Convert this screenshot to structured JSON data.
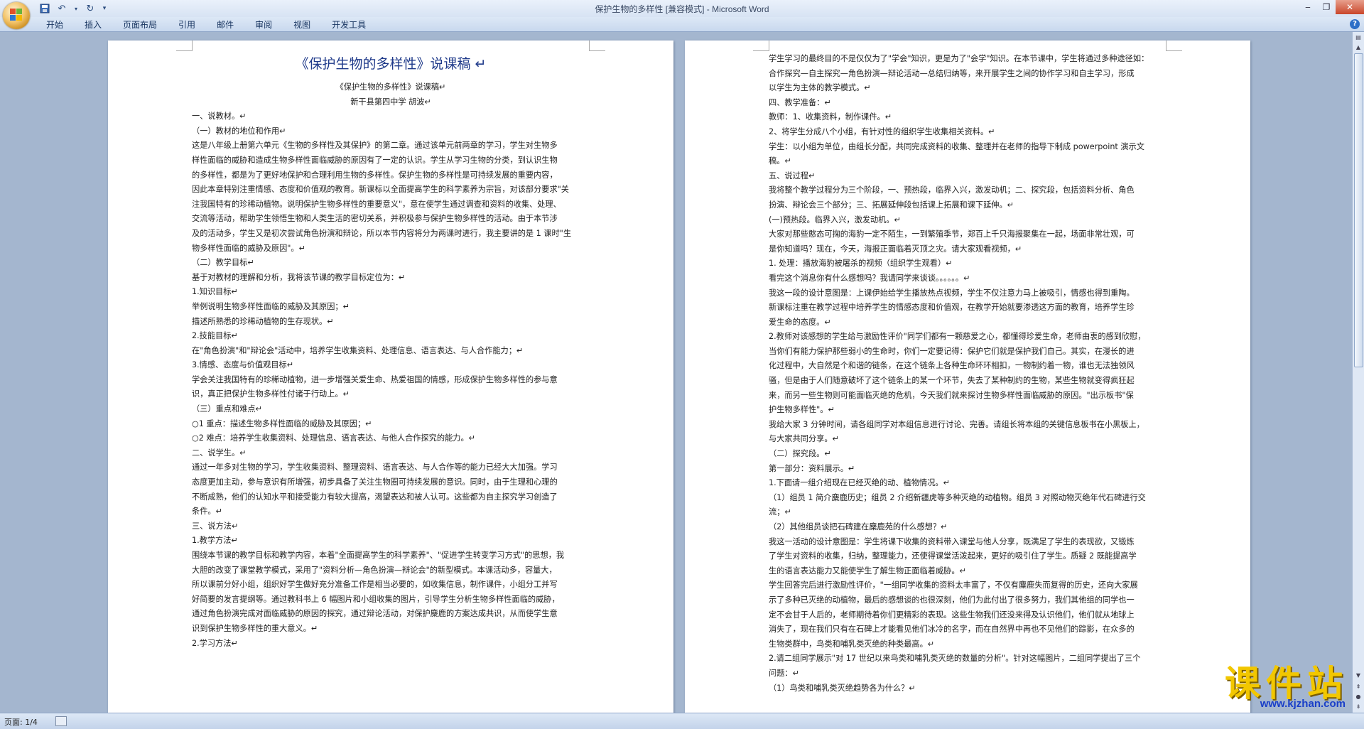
{
  "window": {
    "title": "保护生物的多样性 [兼容模式] - Microsoft Word"
  },
  "quick_access": {
    "icons": [
      "save-icon",
      "undo-icon",
      "redo-icon",
      "customize-icon"
    ]
  },
  "ribbon": {
    "tabs": [
      "开始",
      "插入",
      "页面布局",
      "引用",
      "邮件",
      "审阅",
      "视图",
      "开发工具"
    ]
  },
  "status": {
    "page": "页面: 1/4"
  },
  "watermark": {
    "main": "课件站",
    "url": "www.kjzhan.com"
  },
  "page1": {
    "title": "《保护生物的多样性》说课稿 ↵",
    "lines": [
      "《保护生物的多样性》说课稿↵",
      "新干县第四中学  胡波↵",
      "一、说教材。↵",
      "（一）教材的地位和作用↵",
      "这是八年级上册第六单元《生物的多样性及其保护》的第二章。通过该单元前两章的学习，学生对生物多",
      "样性面临的威胁和造成生物多样性面临威胁的原因有了一定的认识。学生从学习生物的分类，到认识生物",
      "的多样性，都是为了更好地保护和合理利用生物的多样性。保护生物的多样性是可持续发展的重要内容，",
      "因此本章特别注重情感、态度和价值观的教育。新课标以全面提高学生的科学素养为宗旨，对该部分要求\"关",
      "注我国特有的珍稀动植物。说明保护生物多样性的重要意义\"，意在使学生通过调查和资料的收集、处理、",
      "交流等活动，帮助学生领悟生物和人类生活的密切关系，并积极参与保护生物多样性的活动。由于本节涉",
      "及的活动多，学生又是初次尝试角色扮演和辩论，所以本节内容将分为两课时进行，我主要讲的是 1 课时\"生",
      "物多样性面临的威胁及原因\"。↵",
      "（二）教学目标↵",
      "基于对教材的理解和分析，我将该节课的教学目标定位为：↵",
      "1.知识目标↵",
      "举例说明生物多样性面临的威胁及其原因；↵",
      "描述所熟悉的珍稀动植物的生存现状。↵",
      "2.技能目标↵",
      "在\"角色扮演\"和\"辩论会\"活动中，培养学生收集资料、处理信息、语言表达、与人合作能力；↵",
      "3.情感、态度与价值观目标↵",
      "学会关注我国特有的珍稀动植物，进一步增强关爱生命、热爱祖国的情感，形成保护生物多样性的参与意",
      "识，真正把保护生物多样性付诸于行动上。↵",
      "（三）重点和难点↵",
      "○1 重点：描述生物多样性面临的威胁及其原因；↵",
      "○2 难点：培养学生收集资料、处理信息、语言表达、与他人合作探究的能力。↵",
      "二、说学生。↵",
      "通过一年多对生物的学习，学生收集资料、整理资料、语言表达、与人合作等的能力已经大大加强。学习",
      "态度更加主动，参与意识有所增强，初步具备了关注生物圈可持续发展的意识。同时，由于生理和心理的",
      "不断成熟，他们的认知水平和接受能力有较大提高，渴望表达和被人认可。这些都为自主探究学习创造了",
      "条件。↵",
      "三、说方法↵",
      "1.教学方法↵",
      "围绕本节课的教学目标和教学内容，本着\"全面提高学生的科学素养\"、\"促进学生转变学习方式\"的思想，我",
      "大胆的改变了课堂教学模式，采用了\"资料分析—角色扮演—辩论会\"的新型模式。本课活动多，容量大，",
      "所以课前分好小组，组织好学生做好充分准备工作是相当必要的，如收集信息，制作课件，小组分工并写",
      "好简要的发言提纲等。通过教科书上 6 幅图片和小组收集的图片，引导学生分析生物多样性面临的威胁，",
      "通过角色扮演完成对面临威胁的原因的探究，通过辩论活动，对保护麋鹿的方案达成共识，从而使学生意",
      "识到保护生物多样性的重大意义。↵",
      "2.学习方法↵"
    ]
  },
  "page2": {
    "lines": [
      "学生学习的最终目的不是仅仅为了\"学会\"知识，更是为了\"会学\"知识。在本节课中，学生将通过多种途径如：",
      "合作探究—自主探究—角色扮演—辩论活动—总结归纳等，来开展学生之间的协作学习和自主学习，形成",
      "以学生为主体的教学模式。↵",
      "四、教学准备：↵",
      "教师：1、收集资料，制作课件。↵",
      "2、将学生分成八个小组，有针对性的组织学生收集相关资料。↵",
      "学生：以小组为单位，由组长分配，共同完成资料的收集、整理并在老师的指导下制成 powerpoint 演示文",
      "稿。↵",
      "五、说过程↵",
      "我将整个教学过程分为三个阶段，一、预热段，临界入兴，激发动机；二、探究段，包括资料分析、角色",
      "扮演、辩论会三个部分；三、拓展延伸段包括课上拓展和课下延伸。↵",
      "(一)预热段。临界入兴，激发动机。↵",
      "大家对那些憨态可掬的海豹一定不陌生，一到繁殖季节，郑百上千只海报聚集在一起，场面非常壮观，可",
      "是你知道吗？现在，今天，海报正面临着灭顶之灾。请大家观看视频，↵",
      "1. 处理：播放海豹被屠杀的视频（组织学生观看）↵",
      "看完这个消息你有什么感想吗？我请同学来谈谈。。。。。。↵",
      "我这一段的设计意图是：上课伊始给学生播放热点视频，学生不仅注意力马上被吸引，情感也得到重陶。",
      "新课标注重在教学过程中培养学生的情感态度和价值观，在教学开始就要渗透这方面的教育，培养学生珍",
      "爱生命的态度。↵",
      "2.教师对该感想的学生给与激励性评价\"同学们都有一颗慈爱之心，都懂得珍爱生命，老师由衷的感到欣慰，",
      "当你们有能力保护那些弱小的生命时，你们一定要记得：保护它们就是保护我们自己。其实，在漫长的进",
      "化过程中，大自然是个和谐的链条，在这个链条上各种生命环环相扣，一物制约着一物，谁也无法独领风",
      "骚，但是由于人们随意破坏了这个链条上的某一个环节，失去了某种制约的生物，某些生物就变得疯狂起",
      "来，而另一些生物则可能面临灭绝的危机，今天我们就来探讨生物多样性面临威胁的原因。\"出示板书\"保",
      "护生物多样性\"。↵",
      "我给大家 3 分钟时间，请各组同学对本组信息进行讨论、完善。请组长将本组的关键信息板书在小黑板上，",
      "与大家共同分享。↵",
      "（二）探究段。↵",
      "第一部分：资料展示。↵",
      "1.下面请一组介绍现在已经灭绝的动、植物情况。↵",
      "（1）组员 1 简介麋鹿历史；组员 2 介绍新疆虎等多种灭绝的动植物。组员 3 对照动物灭绝年代石碑进行交",
      "流；↵",
      "（2）其他组员谈把石碑建在麋鹿苑的什么感想？↵",
      "我这一活动的设计意图是：学生将课下收集的资料带入课堂与他人分享，既满足了学生的表现欲，又锻炼",
      "了学生对资料的收集，归纳，整理能力，还使得课堂活泼起来，更好的吸引住了学生。质疑 2 既能提高学",
      "生的语言表达能力又能使学生了解生物正面临着威胁。↵",
      "学生回答完后进行激励性评价，\"一组同学收集的资料太丰富了，不仅有麋鹿失而复得的历史，还向大家展",
      "示了多种已灭绝的动植物，最后的感想谈的也很深刻，他们为此付出了很多努力，我们其他组的同学也一",
      "定不会甘于人后的，老师期待着你们更精彩的表现。这些生物我们还没来得及认识他们，他们就从地球上",
      "消失了，现在我们只有在石碑上才能看见他们冰冷的名字，而在自然界中再也不见他们的踪影，在众多的",
      "生物类群中，鸟类和哺乳类灭绝的种类最高。↵",
      "2.请二组同学展示\"对 17 世纪以来鸟类和哺乳类灭绝的数量的分析\"。针对这幅图片，二组同学提出了三个",
      "问题：↵",
      "（1）鸟类和哺乳类灭绝趋势各为什么？↵"
    ]
  }
}
